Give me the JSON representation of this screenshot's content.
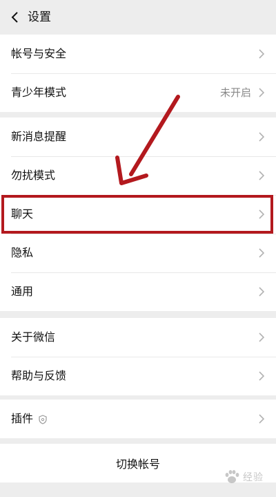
{
  "header": {
    "title": "设置"
  },
  "groups": [
    {
      "items": [
        {
          "label": "帐号与安全"
        },
        {
          "label": "青少年模式",
          "value": "未开启"
        }
      ]
    },
    {
      "items": [
        {
          "label": "新消息提醒"
        },
        {
          "label": "勿扰模式"
        },
        {
          "label": "聊天"
        },
        {
          "label": "隐私"
        },
        {
          "label": "通用"
        }
      ]
    },
    {
      "items": [
        {
          "label": "关于微信"
        },
        {
          "label": "帮助与反馈"
        }
      ]
    },
    {
      "items": [
        {
          "label": "插件"
        }
      ]
    }
  ],
  "footer": {
    "switch_account_label": "切换帐号"
  },
  "annotation": {
    "color": "#b3191e",
    "highlighted_item": "聊天"
  },
  "watermark": {
    "text": "经验"
  },
  "icons": {
    "back": "chevron-left-icon",
    "row_arrow": "chevron-right-icon",
    "plugin": "shield-icon"
  }
}
